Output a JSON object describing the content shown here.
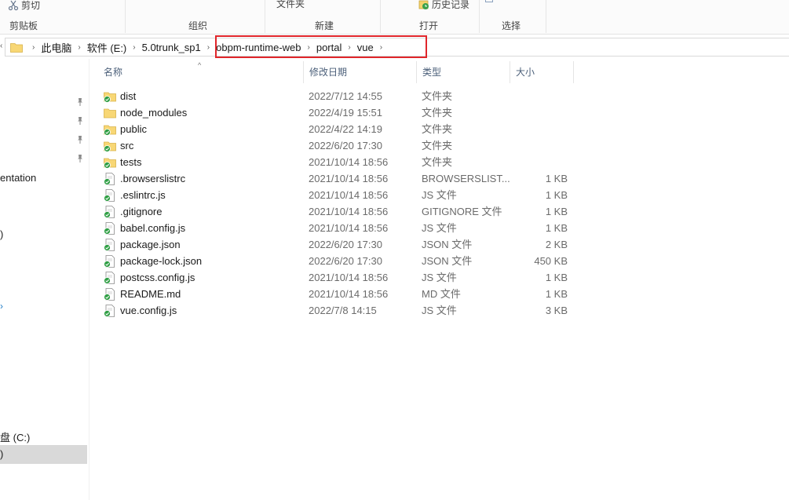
{
  "ribbon": {
    "cut_label": "剪切",
    "clipboard_label": "剪贴板",
    "organize_label": "组织",
    "folder_label": "文件夹",
    "new_label": "新建",
    "history_label": "历史记录",
    "open_label": "打开",
    "select_label": "选择"
  },
  "breadcrumb": {
    "items": [
      "此电脑",
      "软件 (E:)",
      "5.0trunk_sp1",
      "obpm-runtime-web",
      "portal",
      "vue"
    ],
    "separator": "›",
    "highlight_color": "#e0262b"
  },
  "nav": {
    "partial_labels": [
      "entation",
      ")",
      "盘 (C:)",
      ")"
    ]
  },
  "columns": {
    "name": "名称",
    "modified": "修改日期",
    "type": "类型",
    "size": "大小"
  },
  "files": [
    {
      "name": "dist",
      "date": "2022/7/12 14:55",
      "type": "文件夹",
      "size": "",
      "icon": "folder-synced-icon"
    },
    {
      "name": "node_modules",
      "date": "2022/4/19 15:51",
      "type": "文件夹",
      "size": "",
      "icon": "folder-icon"
    },
    {
      "name": "public",
      "date": "2022/4/22 14:19",
      "type": "文件夹",
      "size": "",
      "icon": "folder-synced-icon"
    },
    {
      "name": "src",
      "date": "2022/6/20 17:30",
      "type": "文件夹",
      "size": "",
      "icon": "folder-synced-icon"
    },
    {
      "name": "tests",
      "date": "2021/10/14 18:56",
      "type": "文件夹",
      "size": "",
      "icon": "folder-synced-icon"
    },
    {
      "name": ".browserslistrc",
      "date": "2021/10/14 18:56",
      "type": "BROWSERSLIST...",
      "size": "1 KB",
      "icon": "file-synced-icon"
    },
    {
      "name": ".eslintrc.js",
      "date": "2021/10/14 18:56",
      "type": "JS 文件",
      "size": "1 KB",
      "icon": "file-synced-icon"
    },
    {
      "name": ".gitignore",
      "date": "2021/10/14 18:56",
      "type": "GITIGNORE 文件",
      "size": "1 KB",
      "icon": "file-synced-icon"
    },
    {
      "name": "babel.config.js",
      "date": "2021/10/14 18:56",
      "type": "JS 文件",
      "size": "1 KB",
      "icon": "file-synced-icon"
    },
    {
      "name": "package.json",
      "date": "2022/6/20 17:30",
      "type": "JSON 文件",
      "size": "2 KB",
      "icon": "file-synced-icon"
    },
    {
      "name": "package-lock.json",
      "date": "2022/6/20 17:30",
      "type": "JSON 文件",
      "size": "450 KB",
      "icon": "file-synced-icon"
    },
    {
      "name": "postcss.config.js",
      "date": "2021/10/14 18:56",
      "type": "JS 文件",
      "size": "1 KB",
      "icon": "file-synced-icon"
    },
    {
      "name": "README.md",
      "date": "2021/10/14 18:56",
      "type": "MD 文件",
      "size": "1 KB",
      "icon": "file-synced-icon"
    },
    {
      "name": "vue.config.js",
      "date": "2022/7/8 14:15",
      "type": "JS 文件",
      "size": "3 KB",
      "icon": "file-synced-icon"
    }
  ]
}
